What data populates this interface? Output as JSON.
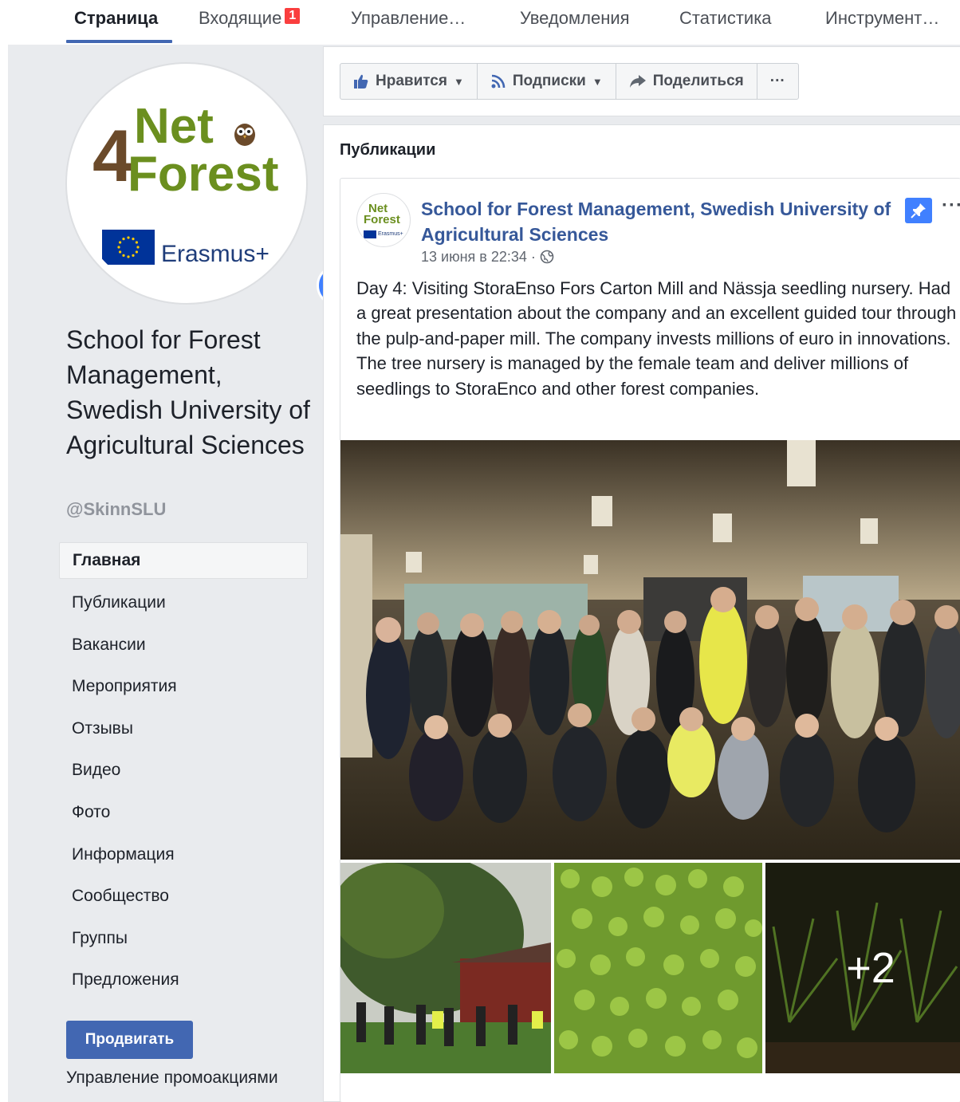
{
  "top_tabs": [
    {
      "label": "Страница"
    },
    {
      "label": "Входящие",
      "badge": "1"
    },
    {
      "label": "Управление…"
    },
    {
      "label": "Уведомления"
    },
    {
      "label": "Статистика"
    },
    {
      "label": "Инструмент…"
    }
  ],
  "profile": {
    "logo": {
      "net": "Net",
      "forest": "Forest",
      "four": "4",
      "erasmus": "Erasmus+"
    },
    "add_icon": "plus-icon",
    "name": "School for Forest Management, Swedish University of Agricultural Sciences",
    "handle": "@SkinnSLU"
  },
  "sidebar": {
    "items": [
      {
        "label": "Главная",
        "active": true
      },
      {
        "label": "Публикации"
      },
      {
        "label": "Вакансии"
      },
      {
        "label": "Мероприятия"
      },
      {
        "label": "Отзывы"
      },
      {
        "label": "Видео"
      },
      {
        "label": "Фото"
      },
      {
        "label": "Информация"
      },
      {
        "label": "Сообщество"
      },
      {
        "label": "Группы"
      },
      {
        "label": "Предложения"
      }
    ],
    "promote_label": "Продвигать",
    "manage_promotions": "Управление промоакциями"
  },
  "actions": {
    "like": {
      "label": "Нравится",
      "icon": "thumbs-up-icon"
    },
    "follow": {
      "label": "Подписки",
      "icon": "rss-icon"
    },
    "share": {
      "label": "Поделиться",
      "icon": "share-arrow-icon"
    },
    "more": "···"
  },
  "posts": {
    "title": "Публикации",
    "post": {
      "avatar_logo": {
        "net": "Net",
        "forest": "Forest",
        "erasmus": "Erasmus+"
      },
      "author": "School for Forest Management, Swedish University of Agricultural Sciences",
      "pinned_icon": "pin-icon",
      "more": "···",
      "date": "13 июня в 22:34",
      "privacy_icon": "globe-icon",
      "text": "Day 4: Visiting StoraEnso Fors Carton Mill and Nässja seedling nursery. Had a great presentation about the company and an excellent guided tour through the pulp-and-paper mill. The company invests millions of euro in innovations. The tree nursery is managed by the female team and deliver millions of seedlings to StoraEnco and other forest companies.",
      "extra_photos": "+2"
    }
  },
  "colors": {
    "link_blue": "#365899",
    "brand_blue": "#4267b2",
    "accent_blue": "#4080ff",
    "badge_red": "#fa3e3e",
    "page_bg": "#e9ebee"
  }
}
